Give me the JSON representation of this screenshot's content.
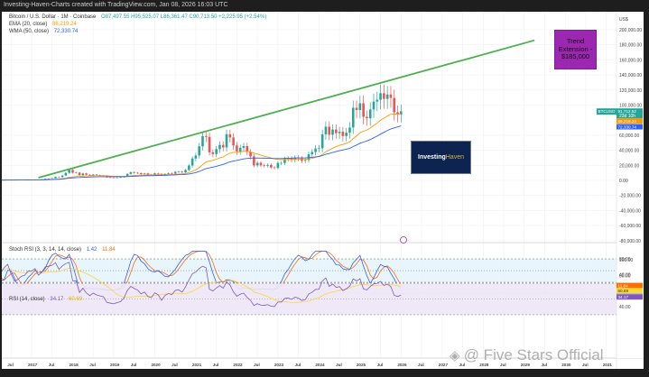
{
  "window_title": "Investing-Haven-Charts created with TradingView.com, Jan 08, 2026 16:03 UTC",
  "legend": {
    "symbol": "Bitcoin / U.S. Dollar · 1M · Coinbase",
    "ohlc": "O87,497.55 H95,525.07 L86,361.47 C90,713.50 +2,225.95 (+2.54%)",
    "ema_label": "EMA (20, close)",
    "ema_value": "86,219.24",
    "wma_label": "WMA (50, close)",
    "wma_value": "72,330.74",
    "stoch_label": "Stoch RSI (3, 3, 14, 14, close)",
    "stoch_k": "1.42",
    "stoch_d": "11.84",
    "rsi_label": "RSI (14, close)",
    "rsi_value": "34.17",
    "rsi_ma": "60.69"
  },
  "annotations": {
    "trend_box": "Trend Extension - $185,000",
    "logo_a": "Investing",
    "logo_b": "Haven",
    "watermark": "@ Five Stars Official"
  },
  "price_tags": {
    "symbol": "BTCUSD",
    "price": "91,712.52",
    "countdown": "23d 10h",
    "ema": "86,219.24",
    "wma": "72,330.74",
    "stoch_d": "11.84",
    "stoch_k": "1.42",
    "rsi_ma": "60.69",
    "rsi": "34.17"
  },
  "colors": {
    "up": "#26a69a",
    "down": "#ef5350",
    "ema": "#ff9800",
    "wma": "#2962ff",
    "trend": "#4caf50",
    "stochK": "#2962ff",
    "stochD": "#ff6d00",
    "rsi": "#7e57c2",
    "rsiMa": "#fdd835"
  },
  "chart_data": {
    "type": "candlestick",
    "title": "Bitcoin / U.S. Dollar · 1M · Coinbase",
    "start": "2016-01",
    "interval": "1M",
    "currency_label": "US$",
    "close_thousands": [
      0.37,
      0.44,
      0.42,
      0.45,
      0.53,
      0.67,
      0.62,
      0.57,
      0.61,
      0.7,
      0.74,
      0.96,
      0.97,
      1.19,
      1.08,
      1.35,
      2.3,
      2.48,
      2.88,
      4.7,
      4.34,
      6.45,
      10.0,
      13.9,
      10.2,
      10.3,
      6.9,
      9.2,
      7.5,
      6.4,
      7.7,
      7.0,
      6.6,
      6.3,
      4.0,
      3.7,
      3.4,
      3.8,
      4.1,
      5.3,
      8.6,
      10.8,
      10.1,
      9.6,
      8.3,
      9.2,
      7.6,
      7.2,
      9.3,
      8.6,
      6.4,
      8.6,
      9.5,
      9.1,
      11.3,
      11.6,
      10.8,
      13.8,
      19.7,
      29.0,
      33.1,
      45.2,
      58.8,
      57.7,
      37.3,
      35.0,
      41.5,
      47.1,
      43.8,
      61.3,
      57.0,
      46.3,
      38.5,
      43.2,
      45.5,
      37.7,
      31.8,
      19.9,
      23.3,
      20.0,
      19.4,
      20.5,
      17.2,
      16.5,
      23.1,
      23.1,
      28.5,
      29.2,
      27.2,
      30.5,
      29.2,
      26.0,
      27.0,
      34.7,
      37.7,
      42.3,
      42.6,
      61.2,
      71.3,
      60.6,
      67.5,
      62.7,
      64.6,
      58.9,
      63.3,
      70.2,
      96.4,
      93.4,
      102.4,
      84.4,
      82.5,
      94.2,
      104.6,
      107.1,
      115.7,
      108.2,
      114.0,
      109.5,
      90.4,
      87.5,
      91.7
    ],
    "trendline": {
      "from": [
        "2017-03",
        3600
      ],
      "to": [
        "2029-04",
        186000
      ]
    },
    "y_axis_labels": [
      "200,000.00",
      "180,000.00",
      "160,000.00",
      "140,000.00",
      "120,000.00",
      "100,000.00",
      "60,000.00",
      "40,000.00",
      "20,000.00",
      "0.00",
      "-20,000.00",
      "-40,000.00",
      "-60,000.00",
      "-80,000.00"
    ],
    "y_axis_values": [
      200000,
      180000,
      160000,
      140000,
      120000,
      100000,
      60000,
      40000,
      20000,
      0,
      -20000,
      -40000,
      -60000,
      -80000
    ],
    "stoch_axis": {
      "labels": [
        "80.00",
        "40.00"
      ],
      "values": [
        80,
        40
      ],
      "bands": [
        80,
        20
      ]
    },
    "rsi_axis": {
      "labels": [
        "100.00",
        "80.00",
        "40.00"
      ],
      "values": [
        100,
        80,
        40
      ],
      "bands": [
        70,
        30
      ]
    },
    "x_labels": [
      "Jul",
      "2017",
      "Jul",
      "2018",
      "Jul",
      "2019",
      "Jul",
      "2020",
      "Jul",
      "2021",
      "Jul",
      "2022",
      "Jul",
      "2023",
      "Jul",
      "2024",
      "Jul",
      "2025",
      "Jul",
      "2026",
      "Jul",
      "2027",
      "Jul",
      "2028",
      "Jul",
      "2029",
      "Jul",
      "2030",
      "Jul",
      "2031"
    ],
    "x_label_start": "2016-07"
  }
}
